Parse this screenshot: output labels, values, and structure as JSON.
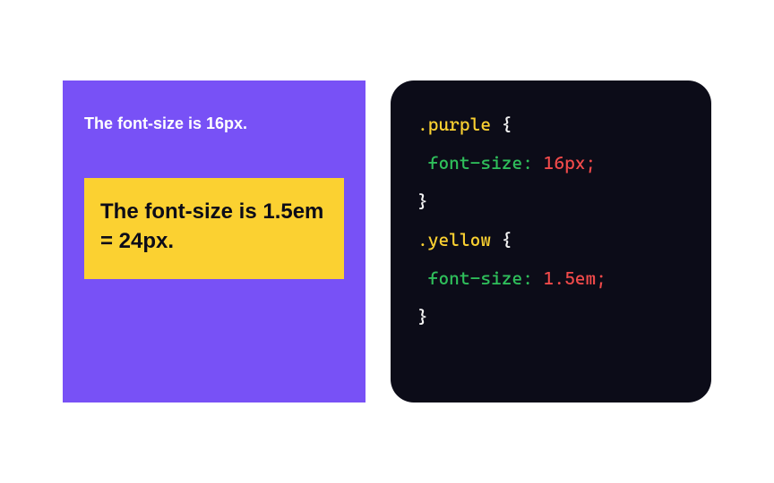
{
  "demo": {
    "purple_text": "The font-size is 16px.",
    "yellow_text": "The font-size is 1.5em = 24px."
  },
  "code": {
    "rule1": {
      "selector": ".purple",
      "open": " {",
      "property": "font-size",
      "colon": ":",
      "value": " 16px",
      "semi": ";",
      "close": "}"
    },
    "rule2": {
      "selector": ".yellow",
      "open": " {",
      "property": "font-size",
      "colon": ":",
      "value": " 1.5em",
      "semi": ";",
      "close": "}"
    }
  },
  "colors": {
    "purple": "#7851f6",
    "yellow": "#fbd131",
    "code_bg": "#0c0c18",
    "code_prop": "#2fbf5b",
    "code_value": "#f04a4a"
  }
}
